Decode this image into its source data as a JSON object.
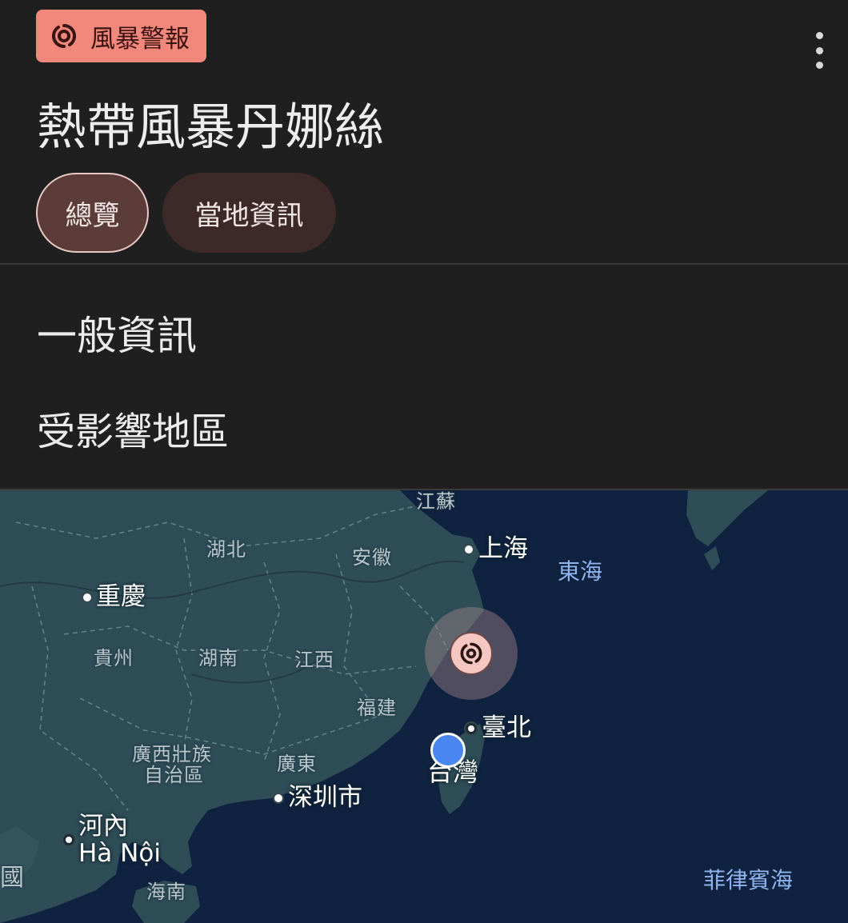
{
  "header": {
    "badge_label": "風暴警報",
    "badge_icon": "cyclone-icon",
    "title": "熱帶風暴丹娜絲",
    "more_icon": "more-vert-icon"
  },
  "tabs": [
    {
      "label": "總覽",
      "selected": true
    },
    {
      "label": "當地資訊",
      "selected": false
    }
  ],
  "sections": {
    "general": "一般資訊",
    "affected_areas": "受影響地區"
  },
  "map": {
    "provinces": {
      "jiangsu": "江蘇",
      "hubei": "湖北",
      "anhui": "安徽",
      "guizhou": "貴州",
      "hunan": "湖南",
      "jiangxi": "江西",
      "fujian": "福建",
      "guangxi_line1": "廣西壯族",
      "guangxi_line2": "自治區",
      "guangdong": "廣東",
      "hainan": "海南",
      "taiwan": "台灣",
      "left_edge": "國"
    },
    "cities": {
      "shanghai": "上海",
      "chongqing": "重慶",
      "taipei": "臺北",
      "shenzhen": "深圳市",
      "hanoi_zh": "河內",
      "hanoi_vi": "Hà Nội"
    },
    "seas": {
      "east_china_sea": "東海",
      "philippine_sea": "菲律賓海"
    },
    "storm_icon": "cyclone-icon",
    "user_location_icon": "my-location-dot"
  },
  "colors": {
    "badge_bg": "#f2877c",
    "tab_selected_bg": "#5b3c39",
    "tab_bg": "#3d2a28",
    "land": "#2f4d57",
    "sea": "#0f2240",
    "location": "#4a86f0"
  }
}
